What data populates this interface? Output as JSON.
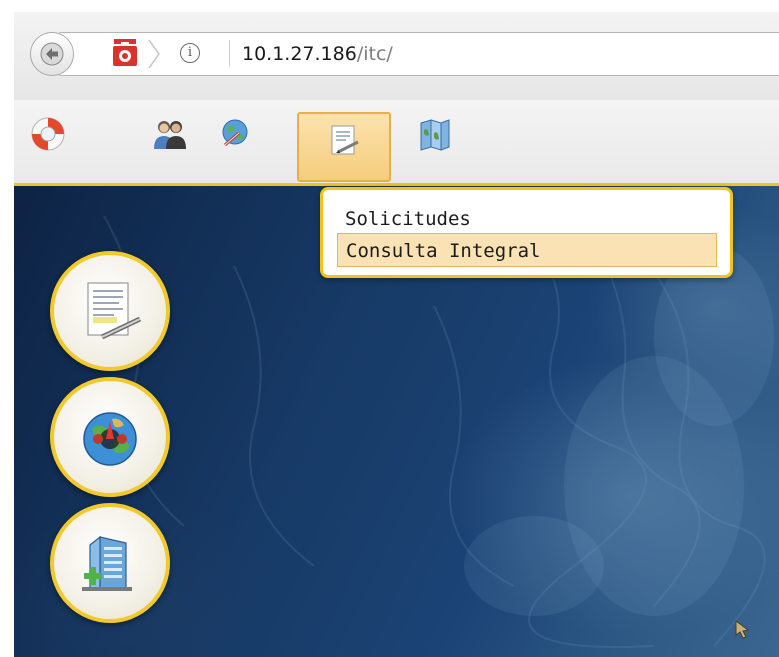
{
  "browser": {
    "url_host": "10.1.27.186",
    "url_path": "/itc/",
    "info_glyph": "i",
    "back_icon": "back-arrow-icon",
    "site_icon": "red-toolbox-icon"
  },
  "toolbar": {
    "tools": [
      {
        "icon": "lifebuoy-icon"
      },
      {
        "icon": "users-icon"
      },
      {
        "icon": "globe-search-icon"
      },
      {
        "icon": "document-edit-icon",
        "active": true
      },
      {
        "icon": "map-book-icon"
      }
    ]
  },
  "dropdown": {
    "items": [
      {
        "label": "Solicitudes"
      },
      {
        "label": "Consulta Integral",
        "highlighted": true
      }
    ]
  },
  "side_buttons": [
    {
      "icon": "document-certificate-icon"
    },
    {
      "icon": "globe-compass-icon"
    },
    {
      "icon": "building-add-icon"
    }
  ],
  "colors": {
    "accent": "#f0c419",
    "highlight": "#fbe2b4",
    "map_dark": "#0d2344",
    "map_light": "#3a6690"
  }
}
